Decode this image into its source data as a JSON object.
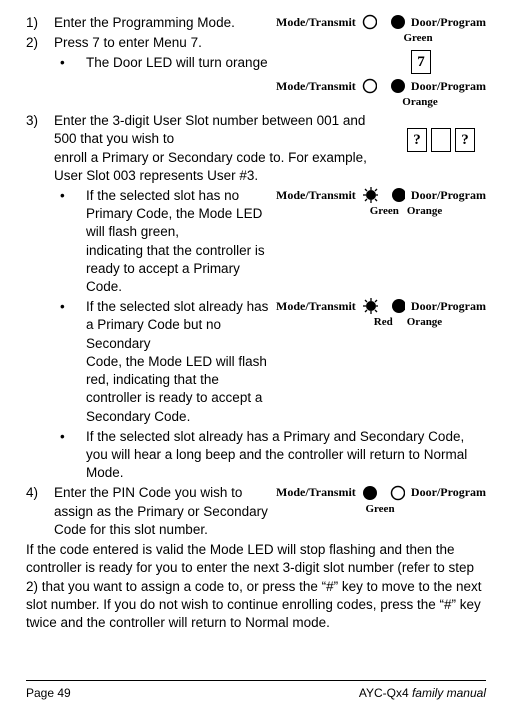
{
  "steps": {
    "s1_num": "1)",
    "s1_text": "Enter the Programming Mode.",
    "s2_num": "2)",
    "s2_text": "Press 7 to enter Menu 7.",
    "s2_bullet": "The Door LED will turn orange",
    "s3_num": "3)",
    "s3_text_a": "Enter the 3-digit User Slot number between 001 and 500 that you wish to",
    "s3_text_b": "enroll a Primary or Secondary code to. For example, User Slot 003 represents User #3.",
    "s3_b1_a": "If the selected slot has no Primary Code, the Mode LED will flash green,",
    "s3_b1_b": "indicating that the controller is ready to accept a Primary Code.",
    "s3_b2_a": "If the selected slot already has a Primary Code but no Secondary",
    "s3_b2_b": "Code, the Mode LED will flash red, indicating that the controller is ready to accept a Secondary Code.",
    "s3_b3": "If the selected slot already has a Primary and Secondary Code, you will hear a long beep and the controller will return to Normal Mode.",
    "s4_num": "4)",
    "s4_text": "Enter the PIN Code you wish to assign as the Primary or Secondary Code for this slot number."
  },
  "tail": "If the code entered is valid the Mode LED will stop flashing and then the controller is ready for you to enter the next 3-digit slot number (refer to step 2) that you want to assign a code to, or press the “#” key to move to the next slot number. If you do not wish to continue enrolling codes, press the “#” key twice and the controller will return to Normal mode.",
  "led": {
    "mode": "Mode/Transmit",
    "door": "Door/Program",
    "green": "Green",
    "orange": "Orange",
    "red": "Red"
  },
  "digits": {
    "seven": "7",
    "q": "?"
  },
  "footer": {
    "page": "Page 49",
    "model": "AYC-Qx4",
    "family": " family manual"
  }
}
